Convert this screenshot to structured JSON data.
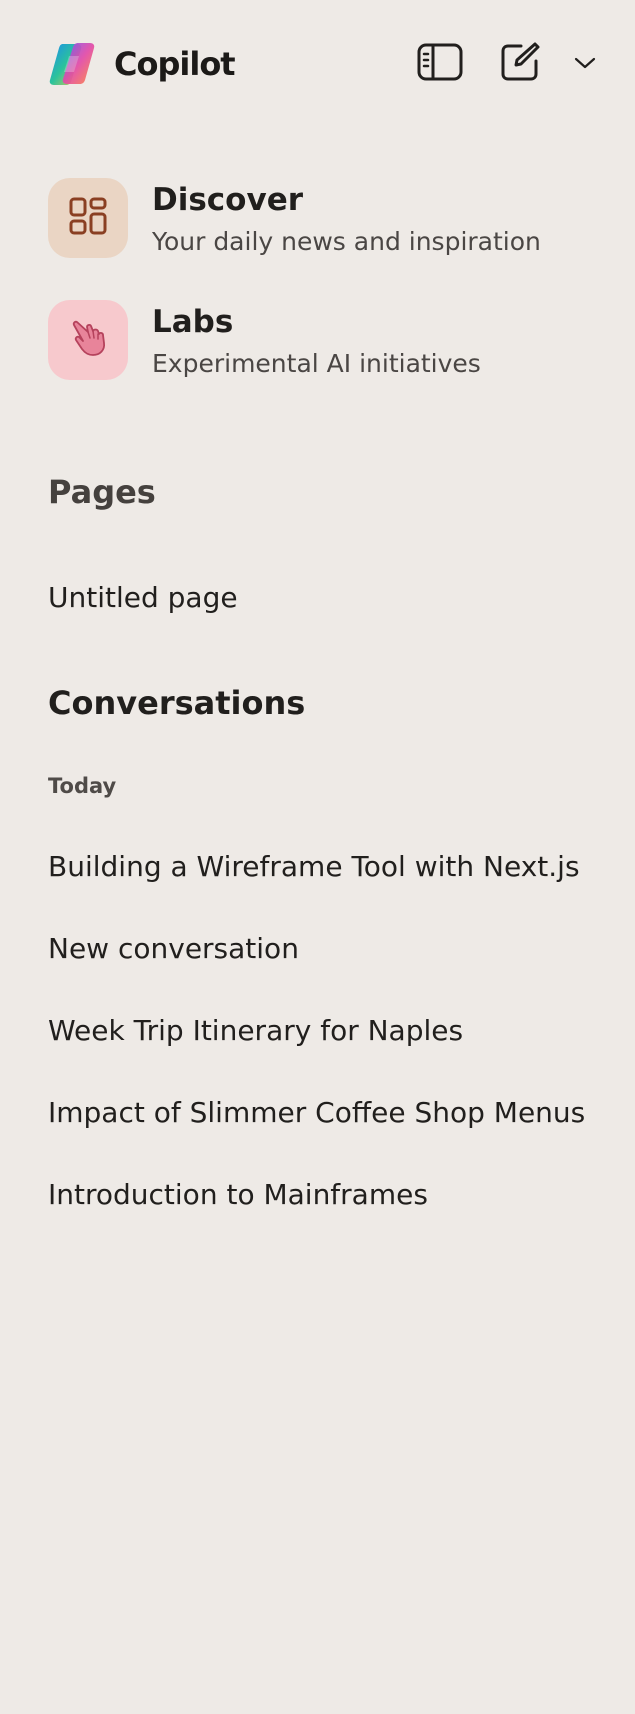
{
  "header": {
    "app_title": "Copilot",
    "logo_icon": "copilot-logo-icon",
    "sidebar_toggle_icon": "sidebar-panel-icon",
    "new_chat_icon": "compose-icon",
    "menu_icon": "chevron-down-icon"
  },
  "features": [
    {
      "title": "Discover",
      "subtitle": "Your daily news and inspiration",
      "icon": "grid-dashboard-icon",
      "tile_color": "#ead5c4"
    },
    {
      "title": "Labs",
      "subtitle": "Experimental AI initiatives",
      "icon": "pointing-hand-icon",
      "tile_color": "#f7c9cd"
    }
  ],
  "pages": {
    "heading": "Pages",
    "items": [
      "Untitled page"
    ]
  },
  "conversations": {
    "heading": "Conversations",
    "groups": [
      {
        "label": "Today",
        "items": [
          "Building a Wireframe Tool with Next.js",
          "New conversation",
          "Week Trip Itinerary for Naples",
          "Impact of Slimmer Coffee Shop Menus",
          "Introduction to Mainframes"
        ]
      }
    ]
  },
  "colors": {
    "background": "#eeeae6",
    "text": "#211f1d",
    "muted_text": "#4a4644"
  }
}
